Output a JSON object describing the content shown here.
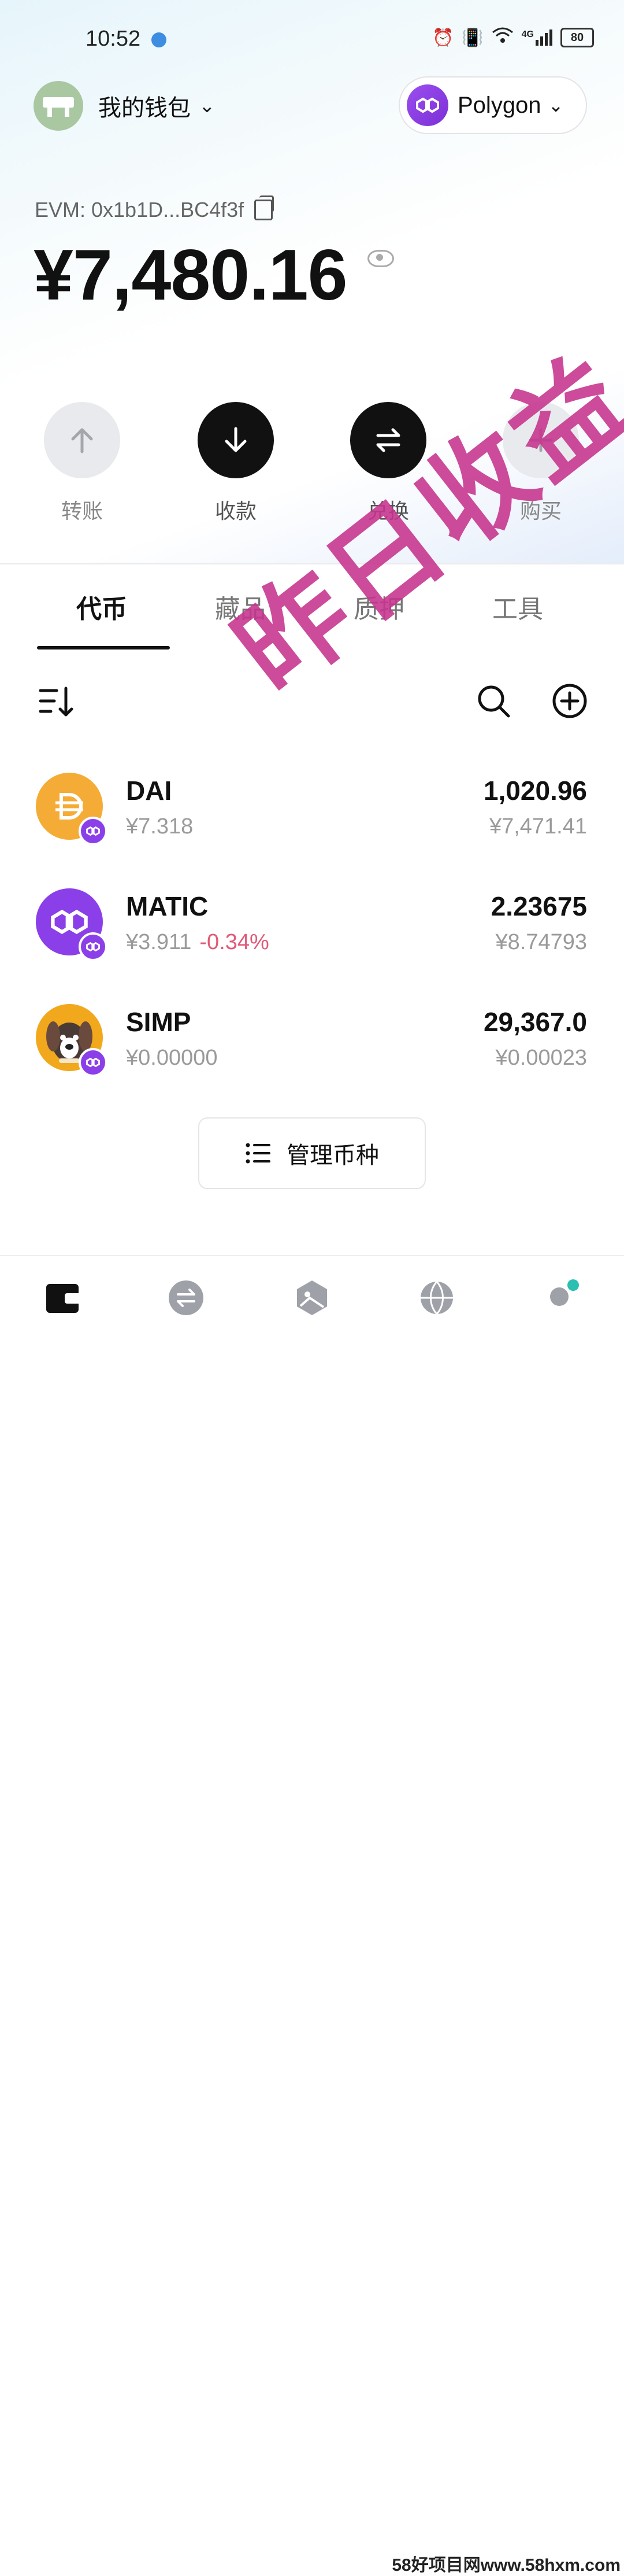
{
  "status_bar": {
    "time": "10:52",
    "signal": "4G",
    "battery": "80"
  },
  "header": {
    "wallet_name": "我的钱包",
    "network": "Polygon"
  },
  "account": {
    "address": "EVM: 0x1b1D...BC4f3f",
    "balance": "¥7,480.16"
  },
  "actions": [
    {
      "label": "转账",
      "icon": "arrow-up-icon"
    },
    {
      "label": "收款",
      "icon": "arrow-down-icon"
    },
    {
      "label": "兑换",
      "icon": "swap-icon"
    },
    {
      "label": "购买",
      "icon": "plus-icon"
    }
  ],
  "tabs": [
    "代币",
    "藏品",
    "质押",
    "工具"
  ],
  "tokens": [
    {
      "symbol": "DAI",
      "price": "¥7.318",
      "change": "",
      "amount": "1,020.96",
      "value": "¥7,471.41",
      "color": "#f5ac37"
    },
    {
      "symbol": "MATIC",
      "price": "¥3.911",
      "change": "-0.34%",
      "amount": "2.23675",
      "value": "¥8.74793",
      "color": "#8b3fe8"
    },
    {
      "symbol": "SIMP",
      "price": "¥0.00000",
      "change": "",
      "amount": "29,367.0",
      "value": "¥0.00023",
      "color": "#f2a81d"
    }
  ],
  "manage_button": "管理币种",
  "watermark": "昨日收益",
  "site_watermark": "58好项目网www.58hxm.com",
  "colors": {
    "accent": "#8b3fe8",
    "negative": "#e05a78",
    "watermark": "#c6338d"
  }
}
